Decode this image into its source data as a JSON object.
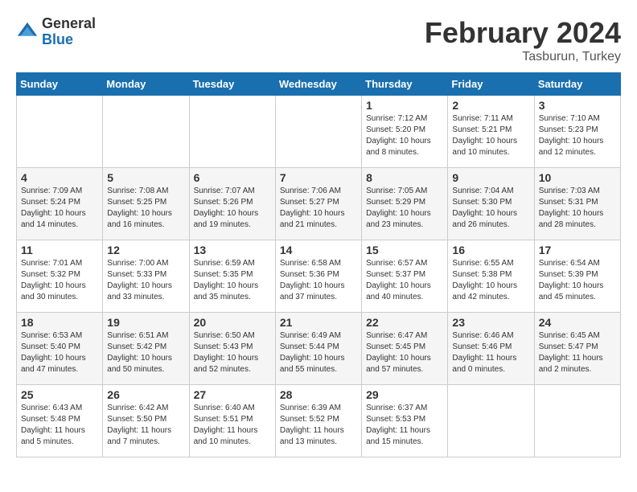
{
  "logo": {
    "general": "General",
    "blue": "Blue"
  },
  "header": {
    "title": "February 2024",
    "subtitle": "Tasburun, Turkey"
  },
  "weekdays": [
    "Sunday",
    "Monday",
    "Tuesday",
    "Wednesday",
    "Thursday",
    "Friday",
    "Saturday"
  ],
  "weeks": [
    [
      {
        "day": "",
        "info": ""
      },
      {
        "day": "",
        "info": ""
      },
      {
        "day": "",
        "info": ""
      },
      {
        "day": "",
        "info": ""
      },
      {
        "day": "1",
        "info": "Sunrise: 7:12 AM\nSunset: 5:20 PM\nDaylight: 10 hours\nand 8 minutes."
      },
      {
        "day": "2",
        "info": "Sunrise: 7:11 AM\nSunset: 5:21 PM\nDaylight: 10 hours\nand 10 minutes."
      },
      {
        "day": "3",
        "info": "Sunrise: 7:10 AM\nSunset: 5:23 PM\nDaylight: 10 hours\nand 12 minutes."
      }
    ],
    [
      {
        "day": "4",
        "info": "Sunrise: 7:09 AM\nSunset: 5:24 PM\nDaylight: 10 hours\nand 14 minutes."
      },
      {
        "day": "5",
        "info": "Sunrise: 7:08 AM\nSunset: 5:25 PM\nDaylight: 10 hours\nand 16 minutes."
      },
      {
        "day": "6",
        "info": "Sunrise: 7:07 AM\nSunset: 5:26 PM\nDaylight: 10 hours\nand 19 minutes."
      },
      {
        "day": "7",
        "info": "Sunrise: 7:06 AM\nSunset: 5:27 PM\nDaylight: 10 hours\nand 21 minutes."
      },
      {
        "day": "8",
        "info": "Sunrise: 7:05 AM\nSunset: 5:29 PM\nDaylight: 10 hours\nand 23 minutes."
      },
      {
        "day": "9",
        "info": "Sunrise: 7:04 AM\nSunset: 5:30 PM\nDaylight: 10 hours\nand 26 minutes."
      },
      {
        "day": "10",
        "info": "Sunrise: 7:03 AM\nSunset: 5:31 PM\nDaylight: 10 hours\nand 28 minutes."
      }
    ],
    [
      {
        "day": "11",
        "info": "Sunrise: 7:01 AM\nSunset: 5:32 PM\nDaylight: 10 hours\nand 30 minutes."
      },
      {
        "day": "12",
        "info": "Sunrise: 7:00 AM\nSunset: 5:33 PM\nDaylight: 10 hours\nand 33 minutes."
      },
      {
        "day": "13",
        "info": "Sunrise: 6:59 AM\nSunset: 5:35 PM\nDaylight: 10 hours\nand 35 minutes."
      },
      {
        "day": "14",
        "info": "Sunrise: 6:58 AM\nSunset: 5:36 PM\nDaylight: 10 hours\nand 37 minutes."
      },
      {
        "day": "15",
        "info": "Sunrise: 6:57 AM\nSunset: 5:37 PM\nDaylight: 10 hours\nand 40 minutes."
      },
      {
        "day": "16",
        "info": "Sunrise: 6:55 AM\nSunset: 5:38 PM\nDaylight: 10 hours\nand 42 minutes."
      },
      {
        "day": "17",
        "info": "Sunrise: 6:54 AM\nSunset: 5:39 PM\nDaylight: 10 hours\nand 45 minutes."
      }
    ],
    [
      {
        "day": "18",
        "info": "Sunrise: 6:53 AM\nSunset: 5:40 PM\nDaylight: 10 hours\nand 47 minutes."
      },
      {
        "day": "19",
        "info": "Sunrise: 6:51 AM\nSunset: 5:42 PM\nDaylight: 10 hours\nand 50 minutes."
      },
      {
        "day": "20",
        "info": "Sunrise: 6:50 AM\nSunset: 5:43 PM\nDaylight: 10 hours\nand 52 minutes."
      },
      {
        "day": "21",
        "info": "Sunrise: 6:49 AM\nSunset: 5:44 PM\nDaylight: 10 hours\nand 55 minutes."
      },
      {
        "day": "22",
        "info": "Sunrise: 6:47 AM\nSunset: 5:45 PM\nDaylight: 10 hours\nand 57 minutes."
      },
      {
        "day": "23",
        "info": "Sunrise: 6:46 AM\nSunset: 5:46 PM\nDaylight: 11 hours\nand 0 minutes."
      },
      {
        "day": "24",
        "info": "Sunrise: 6:45 AM\nSunset: 5:47 PM\nDaylight: 11 hours\nand 2 minutes."
      }
    ],
    [
      {
        "day": "25",
        "info": "Sunrise: 6:43 AM\nSunset: 5:48 PM\nDaylight: 11 hours\nand 5 minutes."
      },
      {
        "day": "26",
        "info": "Sunrise: 6:42 AM\nSunset: 5:50 PM\nDaylight: 11 hours\nand 7 minutes."
      },
      {
        "day": "27",
        "info": "Sunrise: 6:40 AM\nSunset: 5:51 PM\nDaylight: 11 hours\nand 10 minutes."
      },
      {
        "day": "28",
        "info": "Sunrise: 6:39 AM\nSunset: 5:52 PM\nDaylight: 11 hours\nand 13 minutes."
      },
      {
        "day": "29",
        "info": "Sunrise: 6:37 AM\nSunset: 5:53 PM\nDaylight: 11 hours\nand 15 minutes."
      },
      {
        "day": "",
        "info": ""
      },
      {
        "day": "",
        "info": ""
      }
    ]
  ]
}
